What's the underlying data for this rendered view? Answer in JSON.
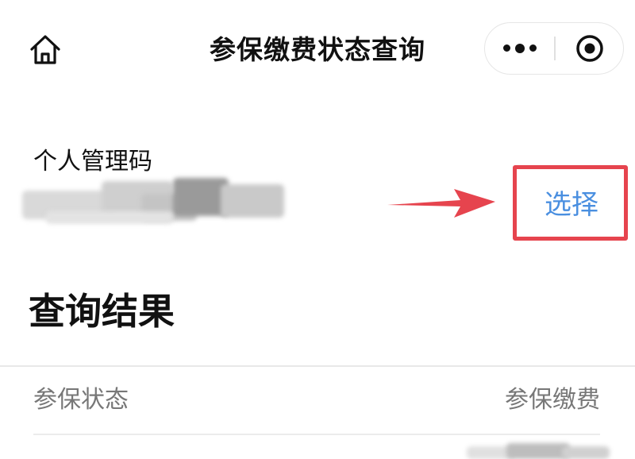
{
  "navbar": {
    "title": "参保缴费状态查询",
    "home_icon": "home-icon",
    "more_icon": "more-dots-icon",
    "close_icon": "target-close-icon"
  },
  "code_section": {
    "label": "个人管理码",
    "value_redacted": true,
    "select_label": "选择",
    "annotation_color": "#e6444e",
    "select_color": "#4a8fe0"
  },
  "results": {
    "title": "查询结果",
    "columns": [
      "参保状态",
      "参保缴费"
    ]
  }
}
